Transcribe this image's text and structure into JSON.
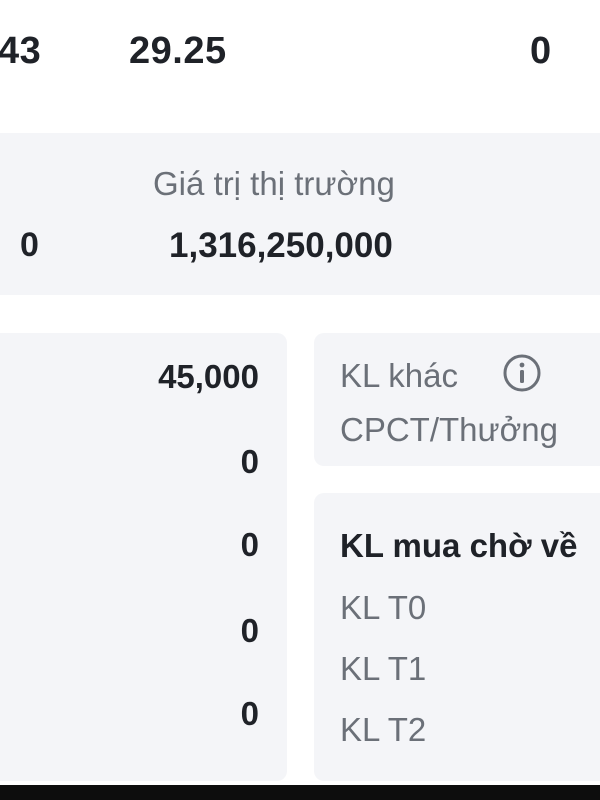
{
  "top_row": {
    "value_1": "43",
    "value_2": "29.25",
    "value_3": "0"
  },
  "market": {
    "left_value": "0",
    "label": "Giá trị thị trường",
    "value": "1,316,250,000"
  },
  "left_values": [
    "45,000",
    "0",
    "0",
    "0",
    "0"
  ],
  "other": {
    "kl_khac_label": "KL khác",
    "cpct_label": "CPCT/Thưởng"
  },
  "pending": {
    "title": "KL mua chờ về",
    "t0_label": "KL T0",
    "t1_label": "KL T1",
    "t2_label": "KL T2"
  },
  "icons": {
    "info": "info-icon"
  },
  "colors": {
    "panel_bg": "#f4f5f8",
    "label_gray": "#6b7078",
    "value_dark": "#1f2228"
  }
}
